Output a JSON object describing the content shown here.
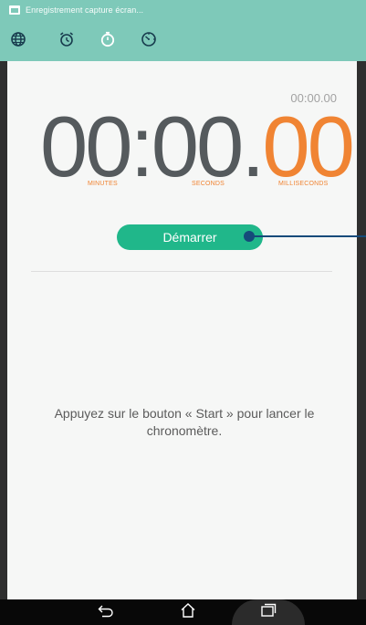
{
  "status_bar": {
    "notification_text": "Enregistrement capture écran..."
  },
  "tabs": [
    {
      "icon": "globe-icon",
      "label": "World clock"
    },
    {
      "icon": "alarm-icon",
      "label": "Alarm"
    },
    {
      "icon": "stopwatch-icon",
      "label": "Stopwatch",
      "selected": true
    },
    {
      "icon": "timer-icon",
      "label": "Timer"
    }
  ],
  "stopwatch": {
    "lap_time": "00:00.00",
    "minutes": "00",
    "sep1": ":",
    "seconds": "00",
    "sep2": ".",
    "milliseconds": "00",
    "label_minutes": "MINUTES",
    "label_seconds": "SECONDS",
    "label_milliseconds": "MILLISECONDS"
  },
  "start_button": {
    "label": "Démarrer"
  },
  "hint": {
    "text": "Appuyez sur le bouton « Start » pour lancer le chronomètre."
  },
  "navigation": {
    "back": "back-icon",
    "home": "home-icon",
    "recents": "recents-icon"
  },
  "colors": {
    "accent_teal": "#7ec9b9",
    "start_green": "#20b78a",
    "ms_orange": "#f08433",
    "digits_gray": "#555a5d"
  }
}
